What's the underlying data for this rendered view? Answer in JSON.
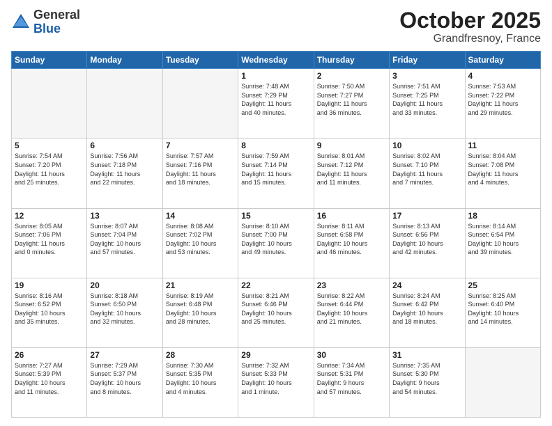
{
  "header": {
    "logo_general": "General",
    "logo_blue": "Blue",
    "month_title": "October 2025",
    "location": "Grandfresnoy, France"
  },
  "weekdays": [
    "Sunday",
    "Monday",
    "Tuesday",
    "Wednesday",
    "Thursday",
    "Friday",
    "Saturday"
  ],
  "weeks": [
    [
      {
        "day": "",
        "info": ""
      },
      {
        "day": "",
        "info": ""
      },
      {
        "day": "",
        "info": ""
      },
      {
        "day": "1",
        "info": "Sunrise: 7:48 AM\nSunset: 7:29 PM\nDaylight: 11 hours\nand 40 minutes."
      },
      {
        "day": "2",
        "info": "Sunrise: 7:50 AM\nSunset: 7:27 PM\nDaylight: 11 hours\nand 36 minutes."
      },
      {
        "day": "3",
        "info": "Sunrise: 7:51 AM\nSunset: 7:25 PM\nDaylight: 11 hours\nand 33 minutes."
      },
      {
        "day": "4",
        "info": "Sunrise: 7:53 AM\nSunset: 7:22 PM\nDaylight: 11 hours\nand 29 minutes."
      }
    ],
    [
      {
        "day": "5",
        "info": "Sunrise: 7:54 AM\nSunset: 7:20 PM\nDaylight: 11 hours\nand 25 minutes."
      },
      {
        "day": "6",
        "info": "Sunrise: 7:56 AM\nSunset: 7:18 PM\nDaylight: 11 hours\nand 22 minutes."
      },
      {
        "day": "7",
        "info": "Sunrise: 7:57 AM\nSunset: 7:16 PM\nDaylight: 11 hours\nand 18 minutes."
      },
      {
        "day": "8",
        "info": "Sunrise: 7:59 AM\nSunset: 7:14 PM\nDaylight: 11 hours\nand 15 minutes."
      },
      {
        "day": "9",
        "info": "Sunrise: 8:01 AM\nSunset: 7:12 PM\nDaylight: 11 hours\nand 11 minutes."
      },
      {
        "day": "10",
        "info": "Sunrise: 8:02 AM\nSunset: 7:10 PM\nDaylight: 11 hours\nand 7 minutes."
      },
      {
        "day": "11",
        "info": "Sunrise: 8:04 AM\nSunset: 7:08 PM\nDaylight: 11 hours\nand 4 minutes."
      }
    ],
    [
      {
        "day": "12",
        "info": "Sunrise: 8:05 AM\nSunset: 7:06 PM\nDaylight: 11 hours\nand 0 minutes."
      },
      {
        "day": "13",
        "info": "Sunrise: 8:07 AM\nSunset: 7:04 PM\nDaylight: 10 hours\nand 57 minutes."
      },
      {
        "day": "14",
        "info": "Sunrise: 8:08 AM\nSunset: 7:02 PM\nDaylight: 10 hours\nand 53 minutes."
      },
      {
        "day": "15",
        "info": "Sunrise: 8:10 AM\nSunset: 7:00 PM\nDaylight: 10 hours\nand 49 minutes."
      },
      {
        "day": "16",
        "info": "Sunrise: 8:11 AM\nSunset: 6:58 PM\nDaylight: 10 hours\nand 46 minutes."
      },
      {
        "day": "17",
        "info": "Sunrise: 8:13 AM\nSunset: 6:56 PM\nDaylight: 10 hours\nand 42 minutes."
      },
      {
        "day": "18",
        "info": "Sunrise: 8:14 AM\nSunset: 6:54 PM\nDaylight: 10 hours\nand 39 minutes."
      }
    ],
    [
      {
        "day": "19",
        "info": "Sunrise: 8:16 AM\nSunset: 6:52 PM\nDaylight: 10 hours\nand 35 minutes."
      },
      {
        "day": "20",
        "info": "Sunrise: 8:18 AM\nSunset: 6:50 PM\nDaylight: 10 hours\nand 32 minutes."
      },
      {
        "day": "21",
        "info": "Sunrise: 8:19 AM\nSunset: 6:48 PM\nDaylight: 10 hours\nand 28 minutes."
      },
      {
        "day": "22",
        "info": "Sunrise: 8:21 AM\nSunset: 6:46 PM\nDaylight: 10 hours\nand 25 minutes."
      },
      {
        "day": "23",
        "info": "Sunrise: 8:22 AM\nSunset: 6:44 PM\nDaylight: 10 hours\nand 21 minutes."
      },
      {
        "day": "24",
        "info": "Sunrise: 8:24 AM\nSunset: 6:42 PM\nDaylight: 10 hours\nand 18 minutes."
      },
      {
        "day": "25",
        "info": "Sunrise: 8:25 AM\nSunset: 6:40 PM\nDaylight: 10 hours\nand 14 minutes."
      }
    ],
    [
      {
        "day": "26",
        "info": "Sunrise: 7:27 AM\nSunset: 5:39 PM\nDaylight: 10 hours\nand 11 minutes."
      },
      {
        "day": "27",
        "info": "Sunrise: 7:29 AM\nSunset: 5:37 PM\nDaylight: 10 hours\nand 8 minutes."
      },
      {
        "day": "28",
        "info": "Sunrise: 7:30 AM\nSunset: 5:35 PM\nDaylight: 10 hours\nand 4 minutes."
      },
      {
        "day": "29",
        "info": "Sunrise: 7:32 AM\nSunset: 5:33 PM\nDaylight: 10 hours\nand 1 minute."
      },
      {
        "day": "30",
        "info": "Sunrise: 7:34 AM\nSunset: 5:31 PM\nDaylight: 9 hours\nand 57 minutes."
      },
      {
        "day": "31",
        "info": "Sunrise: 7:35 AM\nSunset: 5:30 PM\nDaylight: 9 hours\nand 54 minutes."
      },
      {
        "day": "",
        "info": ""
      }
    ]
  ]
}
